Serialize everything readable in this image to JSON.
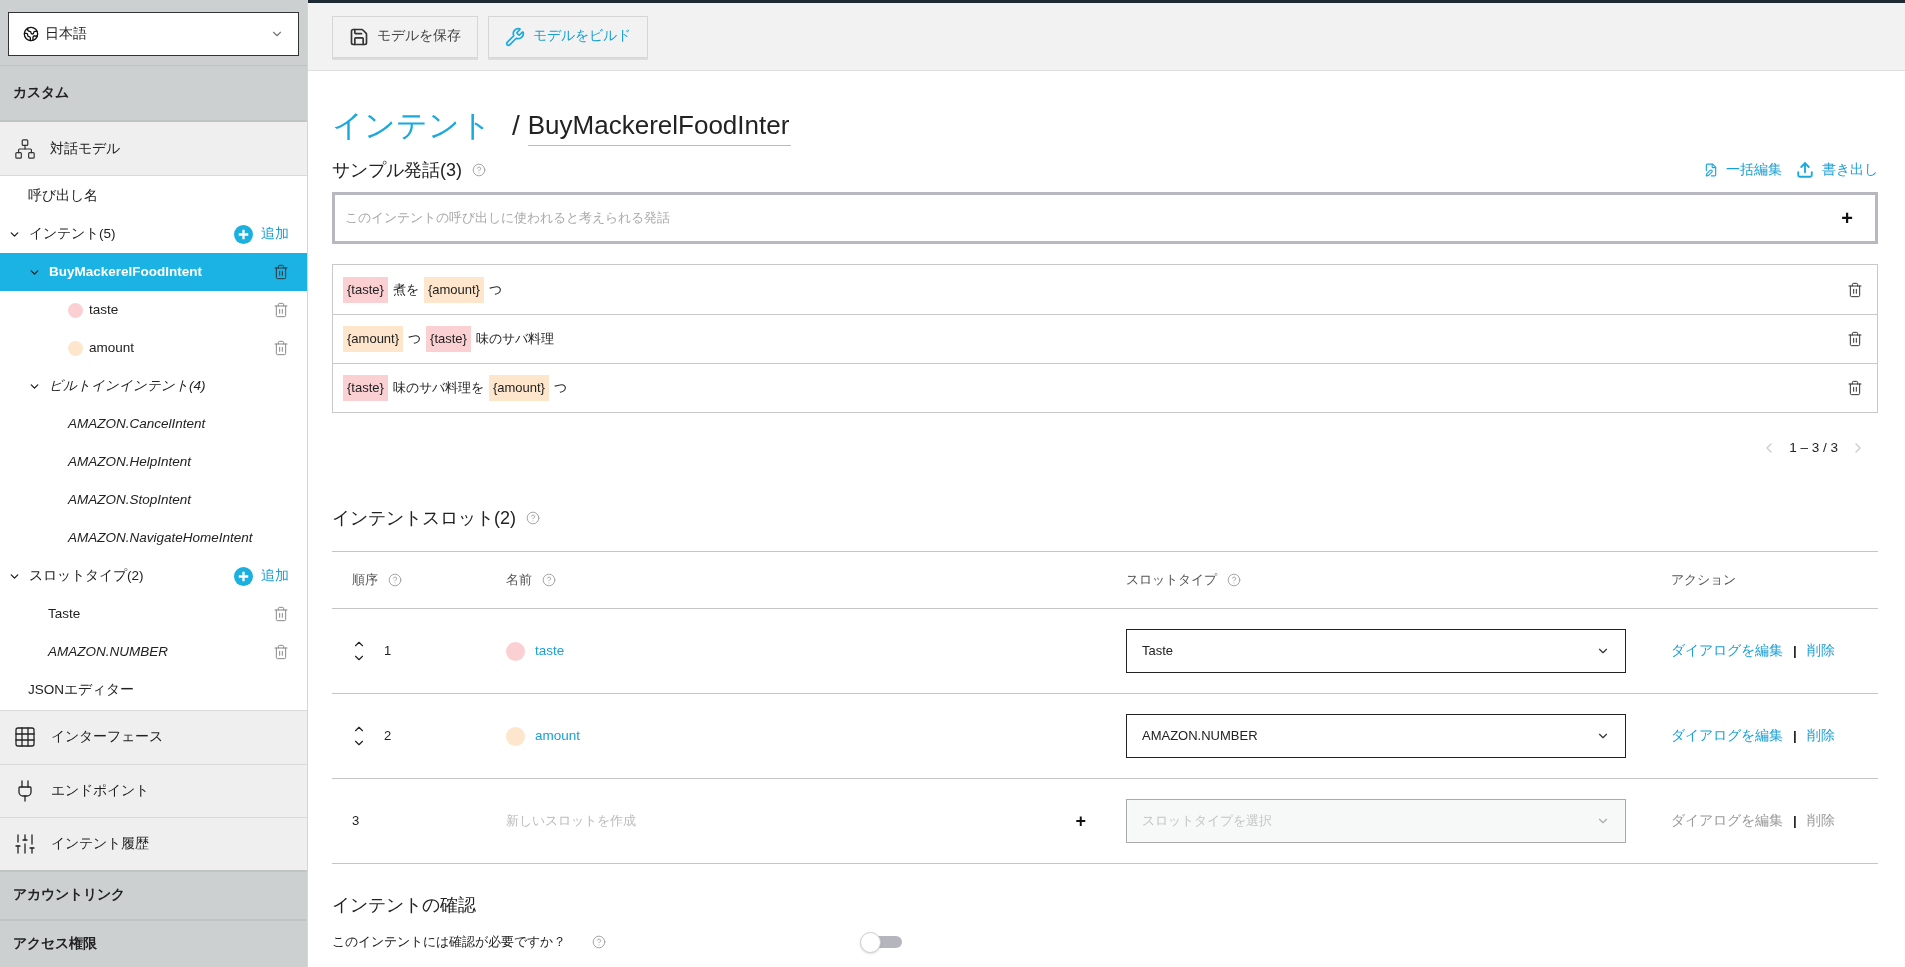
{
  "sidebar": {
    "language": "日本語",
    "custom_heading": "カスタム",
    "model_nav": "対話モデル",
    "tree": [
      {
        "kind": "link",
        "label": "呼び出し名",
        "selected": false
      },
      {
        "kind": "group",
        "label": "インテント(5)",
        "expanded": true,
        "action": "追加",
        "selected": false,
        "children": [
          {
            "kind": "intent",
            "label": "BuyMackerelFoodIntent",
            "expanded": true,
            "selected": true,
            "children": [
              {
                "kind": "slot",
                "label": "taste",
                "color": "#fbd0d3",
                "selected": false
              },
              {
                "kind": "slot",
                "label": "amount",
                "color": "#fde6cb",
                "selected": false
              }
            ]
          },
          {
            "kind": "builtin_group",
            "label": "ビルトインインテント(4)",
            "expanded": true,
            "selected": false,
            "children": [
              {
                "kind": "builtin",
                "label": "AMAZON.CancelIntent",
                "selected": false
              },
              {
                "kind": "builtin",
                "label": "AMAZON.HelpIntent",
                "selected": false
              },
              {
                "kind": "builtin",
                "label": "AMAZON.StopIntent",
                "selected": false
              },
              {
                "kind": "builtin",
                "label": "AMAZON.NavigateHomeIntent",
                "selected": false
              }
            ]
          }
        ]
      },
      {
        "kind": "group",
        "label": "スロットタイプ(2)",
        "expanded": true,
        "action": "追加",
        "selected": false,
        "children": [
          {
            "kind": "custom_type",
            "label": "Taste",
            "selected": false
          },
          {
            "kind": "builtin_type",
            "label": "AMAZON.NUMBER",
            "selected": false
          }
        ]
      },
      {
        "kind": "link",
        "label": "JSONエディター",
        "selected": false
      }
    ],
    "nav_items": [
      {
        "kind": "grid",
        "label": "インターフェース"
      },
      {
        "kind": "plug",
        "label": "エンドポイント"
      },
      {
        "kind": "sliders",
        "label": "インテント履歴"
      }
    ],
    "sections": [
      "アカウントリンク",
      "アクセス権限"
    ]
  },
  "toolbar": {
    "buttons": [
      {
        "kind": "save",
        "label": "モデルを保存"
      },
      {
        "kind": "build",
        "label": "モデルをビルド"
      }
    ]
  },
  "breadcrumb": {
    "parent": "インテント",
    "separator": "/",
    "name": "BuyMackerelFoodInter"
  },
  "samples": {
    "heading": "サンプル発話(3)",
    "actions": [
      {
        "kind": "bulk_edit",
        "label": "一括編集"
      },
      {
        "kind": "export",
        "label": "書き出し"
      }
    ],
    "placeholder": "このインテントの呼び出しに使われると考えられる発話",
    "add": "+",
    "utterances": [
      {
        "parts": [
          {
            "kind": "slot",
            "text": "{taste}",
            "color": "#fbd0d3"
          },
          {
            "kind": "text",
            "text": "煮を"
          },
          {
            "kind": "slot",
            "text": "{amount}",
            "color": "#fde6cb"
          },
          {
            "kind": "text",
            "text": "つ"
          }
        ]
      },
      {
        "parts": [
          {
            "kind": "slot",
            "text": "{amount}",
            "color": "#fde6cb"
          },
          {
            "kind": "text",
            "text": "つ"
          },
          {
            "kind": "slot",
            "text": "{taste}",
            "color": "#fbd0d3"
          },
          {
            "kind": "text",
            "text": "味のサバ料理"
          }
        ]
      },
      {
        "parts": [
          {
            "kind": "slot",
            "text": "{taste}",
            "color": "#fbd0d3"
          },
          {
            "kind": "text",
            "text": "味のサバ料理を"
          },
          {
            "kind": "slot",
            "text": "{amount}",
            "color": "#fde6cb"
          },
          {
            "kind": "text",
            "text": "つ"
          }
        ]
      }
    ],
    "pagination": "1 – 3 / 3"
  },
  "slots": {
    "heading": "インテントスロット(2)",
    "columns": [
      {
        "label": "順序",
        "help": true
      },
      {
        "label": "名前",
        "help": true
      },
      {
        "label": "スロットタイプ",
        "help": true
      },
      {
        "label": "アクション",
        "help": false
      }
    ],
    "rows": [
      {
        "kind": "slot",
        "order": "1",
        "name": "taste",
        "color": "#fbd0d3",
        "type": "Taste",
        "edit": "ダイアログを編集",
        "separator": "|",
        "delete": "削除"
      },
      {
        "kind": "slot",
        "order": "2",
        "name": "amount",
        "color": "#fde6cb",
        "type": "AMAZON.NUMBER",
        "edit": "ダイアログを編集",
        "separator": "|",
        "delete": "削除"
      },
      {
        "kind": "new",
        "order": "3",
        "placeholder": "新しいスロットを作成",
        "add": "+",
        "type_placeholder": "スロットタイプを選択",
        "edit": "ダイアログを編集",
        "separator": "|",
        "delete": "削除"
      }
    ]
  },
  "confirmation": {
    "heading": "インテントの確認",
    "question": "このインテントには確認が必要ですか？",
    "on": false
  }
}
